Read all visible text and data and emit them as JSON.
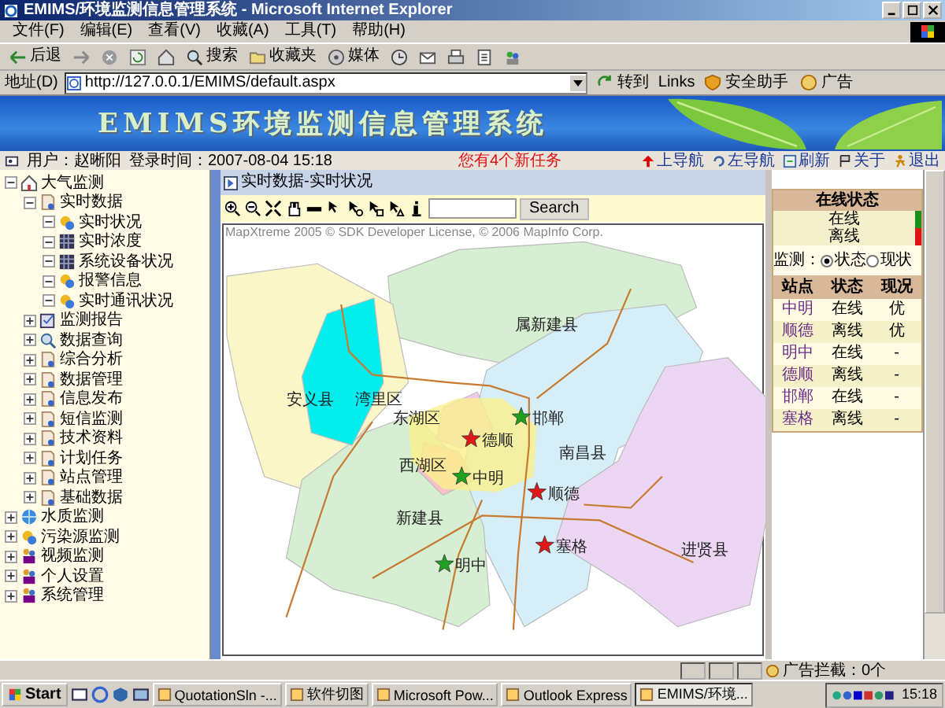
{
  "window": {
    "title": "EMIMS/环境监测信息管理系统 - Microsoft Internet Explorer"
  },
  "menu": [
    "文件(F)",
    "编辑(E)",
    "查看(V)",
    "收藏(A)",
    "工具(T)",
    "帮助(H)"
  ],
  "toolbar": [
    {
      "kind": "back",
      "label": "后退"
    },
    {
      "kind": "forward"
    },
    {
      "kind": "stop"
    },
    {
      "kind": "refresh"
    },
    {
      "kind": "home"
    },
    {
      "kind": "search",
      "label": "搜索"
    },
    {
      "kind": "favorites",
      "label": "收藏夹"
    },
    {
      "kind": "media",
      "label": "媒体"
    },
    {
      "kind": "history"
    },
    {
      "kind": "mail"
    },
    {
      "kind": "print"
    },
    {
      "kind": "edit"
    },
    {
      "kind": "messenger"
    }
  ],
  "address": {
    "label": "地址(D)",
    "url": "http://127.0.0.1/EMIMS/default.aspx",
    "go": "转到",
    "links": "Links",
    "helper": "安全助手",
    "ads": "广告"
  },
  "banner": {
    "title": "EMIMS环境监测信息管理系统"
  },
  "info": {
    "user": "用户：赵晰阳",
    "login": "登录时间：2007-08-04 15:18",
    "notice": "您有4个新任务",
    "nav": [
      {
        "kind": "up",
        "label": "上导航"
      },
      {
        "kind": "left",
        "label": "左导航"
      },
      {
        "kind": "refresh",
        "label": "刷新"
      },
      {
        "kind": "about",
        "label": "关于"
      },
      {
        "kind": "exit",
        "label": "退出"
      }
    ]
  },
  "tree": [
    {
      "label": "大气监测",
      "kind": "home",
      "expanded": true,
      "children": [
        {
          "label": "实时数据",
          "kind": "page",
          "expanded": true,
          "children": [
            {
              "label": "实时状况",
              "kind": "gear",
              "expanded": true
            },
            {
              "label": "实时浓度",
              "kind": "grid",
              "expanded": true
            },
            {
              "label": "系统设备状况",
              "kind": "grid",
              "expanded": true
            },
            {
              "label": "报警信息",
              "kind": "gear",
              "expanded": true
            },
            {
              "label": "实时通讯状况",
              "kind": "gear",
              "expanded": true
            }
          ]
        },
        {
          "label": "监测报告",
          "kind": "report",
          "expanded": false
        },
        {
          "label": "数据查询",
          "kind": "search",
          "expanded": false
        },
        {
          "label": "综合分析",
          "kind": "page",
          "expanded": false
        },
        {
          "label": "数据管理",
          "kind": "page",
          "expanded": false
        },
        {
          "label": "信息发布",
          "kind": "page",
          "expanded": false
        },
        {
          "label": "短信监测",
          "kind": "page",
          "expanded": false
        },
        {
          "label": "技术资料",
          "kind": "page",
          "expanded": false
        },
        {
          "label": "计划任务",
          "kind": "page",
          "expanded": false
        },
        {
          "label": "站点管理",
          "kind": "page",
          "expanded": false
        },
        {
          "label": "基础数据",
          "kind": "page",
          "expanded": false
        }
      ]
    },
    {
      "label": "水质监测",
      "kind": "globe",
      "expanded": false
    },
    {
      "label": "污染源监测",
      "kind": "gear",
      "expanded": false
    },
    {
      "label": "视频监测",
      "kind": "people",
      "expanded": false
    },
    {
      "label": "个人设置",
      "kind": "people",
      "expanded": false
    },
    {
      "label": "系统管理",
      "kind": "people",
      "expanded": false
    }
  ],
  "content": {
    "breadcrumb": "实时数据-实时状况",
    "search_button": "Search",
    "copyright": "MapXtreme 2005 © SDK Developer License, © 2006 MapInfo Corp.",
    "map": {
      "regions": [
        {
          "name": "属新建县",
          "color": "#d6efd2"
        },
        {
          "name": "南昌县",
          "color": "#d6eef8"
        },
        {
          "name": "进贤县",
          "color": "#ecd6f4"
        },
        {
          "name": "安义县",
          "color": "#faf6c8"
        },
        {
          "name": "新建县",
          "color": "#d6efd2"
        },
        {
          "name": "湾里区",
          "color": "#00eeee"
        },
        {
          "name": "东湖区",
          "color": "#f4c8ec"
        },
        {
          "name": "西湖区",
          "color": "#f8c0c8"
        }
      ],
      "stations": [
        {
          "label": "邯郸",
          "online": true
        },
        {
          "label": "德顺",
          "online": false
        },
        {
          "label": "中明",
          "online": true
        },
        {
          "label": "顺德",
          "online": false
        },
        {
          "label": "塞格",
          "online": false
        },
        {
          "label": "明中",
          "online": true
        }
      ]
    }
  },
  "status_panel": {
    "title": "在线状态",
    "legend": [
      {
        "label": "在线",
        "color": "#18901c"
      },
      {
        "label": "离线",
        "color": "#e01414"
      }
    ],
    "monitor_label": "监测：",
    "options": [
      {
        "label": "状态",
        "selected": true
      },
      {
        "label": "现状",
        "selected": false
      }
    ],
    "columns": [
      "站点",
      "状态",
      "现况"
    ],
    "rows": [
      {
        "station": "中明",
        "status": "在线",
        "condition": "优"
      },
      {
        "station": "顺德",
        "status": "离线",
        "condition": "优"
      },
      {
        "station": "明中",
        "status": "在线",
        "condition": "-"
      },
      {
        "station": "德顺",
        "status": "离线",
        "condition": "-"
      },
      {
        "station": "邯郸",
        "status": "在线",
        "condition": "-"
      },
      {
        "station": "塞格",
        "status": "离线",
        "condition": "-"
      }
    ]
  },
  "status_bar": {
    "text": "广告拦截：0个"
  },
  "taskbar": {
    "start": "Start",
    "tasks": [
      {
        "label": "QuotationSln -...",
        "selected": false
      },
      {
        "label": "软件切图",
        "selected": false
      },
      {
        "label": "Microsoft Pow...",
        "selected": false
      },
      {
        "label": "Outlook Express",
        "selected": false
      },
      {
        "label": "EMIMS/环境...",
        "selected": true
      }
    ],
    "clock": "15:18"
  }
}
